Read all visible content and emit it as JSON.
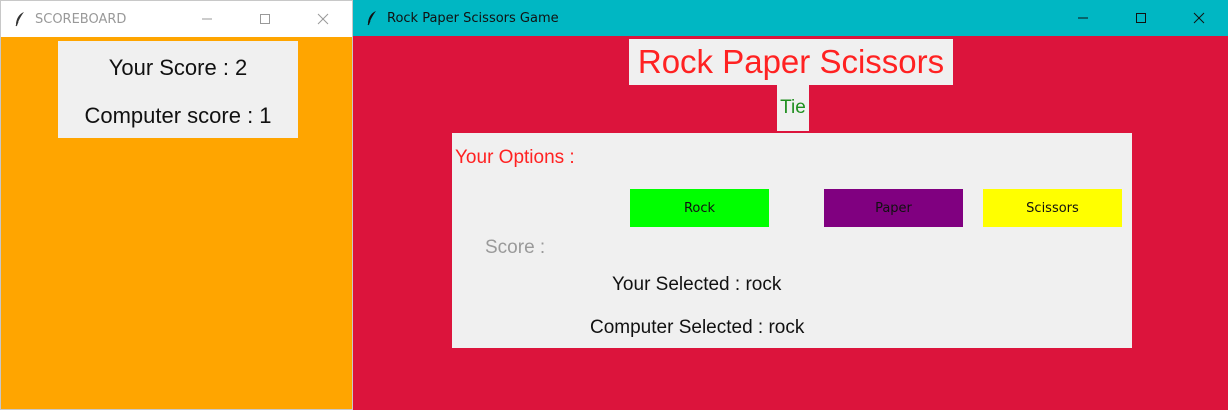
{
  "scoreboard": {
    "window_title": "SCOREBOARD",
    "your_score": "Your Score : 2",
    "computer_score": "Computer score  : 1",
    "background": "#ffa500"
  },
  "game": {
    "window_title": "Rock Paper Scissors Game",
    "heading": "Rock Paper Scissors",
    "result": "Tie",
    "options_label": "Your Options :",
    "buttons": [
      {
        "label": "Rock",
        "color": "#00ff00"
      },
      {
        "label": "Paper",
        "color": "#800080"
      },
      {
        "label": "Scissors",
        "color": "#ffff00"
      }
    ],
    "score_label": "Score :",
    "your_selected": "Your Selected : rock",
    "computer_selected": "Computer Selected : rock",
    "background": "#dc143c",
    "titlebar_color": "#00b7c3"
  }
}
